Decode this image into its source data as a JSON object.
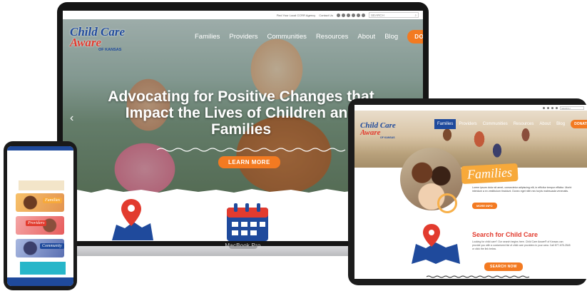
{
  "site": {
    "logo_line1": "Child Care",
    "logo_line2": "Aware",
    "logo_sub": "OF KANSAS"
  },
  "laptop": {
    "device_label": "MacBook Pro",
    "util": {
      "link1": "Find Your Local CCRR Agency",
      "link2": "Contact Us",
      "search_placeholder": "SEARCH"
    },
    "nav": [
      "Families",
      "Providers",
      "Communities",
      "Resources",
      "About",
      "Blog"
    ],
    "donate_label": "DONATE",
    "headline": "Advocating for Positive Changes that Impact the Lives of Children and Families",
    "cta_label": "LEARN MORE"
  },
  "tablet": {
    "nav": [
      "Families",
      "Providers",
      "Communities",
      "Resources",
      "About",
      "Blog"
    ],
    "donate_label": "DONATE",
    "search_placeholder": "SEARCH",
    "families_title": "Families",
    "families_text": "Lorem ipsum dolor sit amet, consectetur adipiscing elit, in efficitur tempor efficitur. Morbi interdum a ex vestibulum tincidunt. Donec eget nibh nec turpis malesuada venenatis.",
    "more_label": "MORE INFO",
    "search_title": "Search for Child Care",
    "search_text": "Looking for child care? Our search begins here. Child Care Aware® of Kansas can provide you with a customized list of child care providers in your area. Call 877-678-2548 or click the link below.",
    "search_label": "SEARCH NOW"
  },
  "phone": {
    "tags": [
      "Families",
      "Providers",
      "Community"
    ]
  },
  "colors": {
    "brand_blue": "#1f4a9c",
    "brand_red": "#e23b2e",
    "accent_orange": "#f37a21"
  }
}
